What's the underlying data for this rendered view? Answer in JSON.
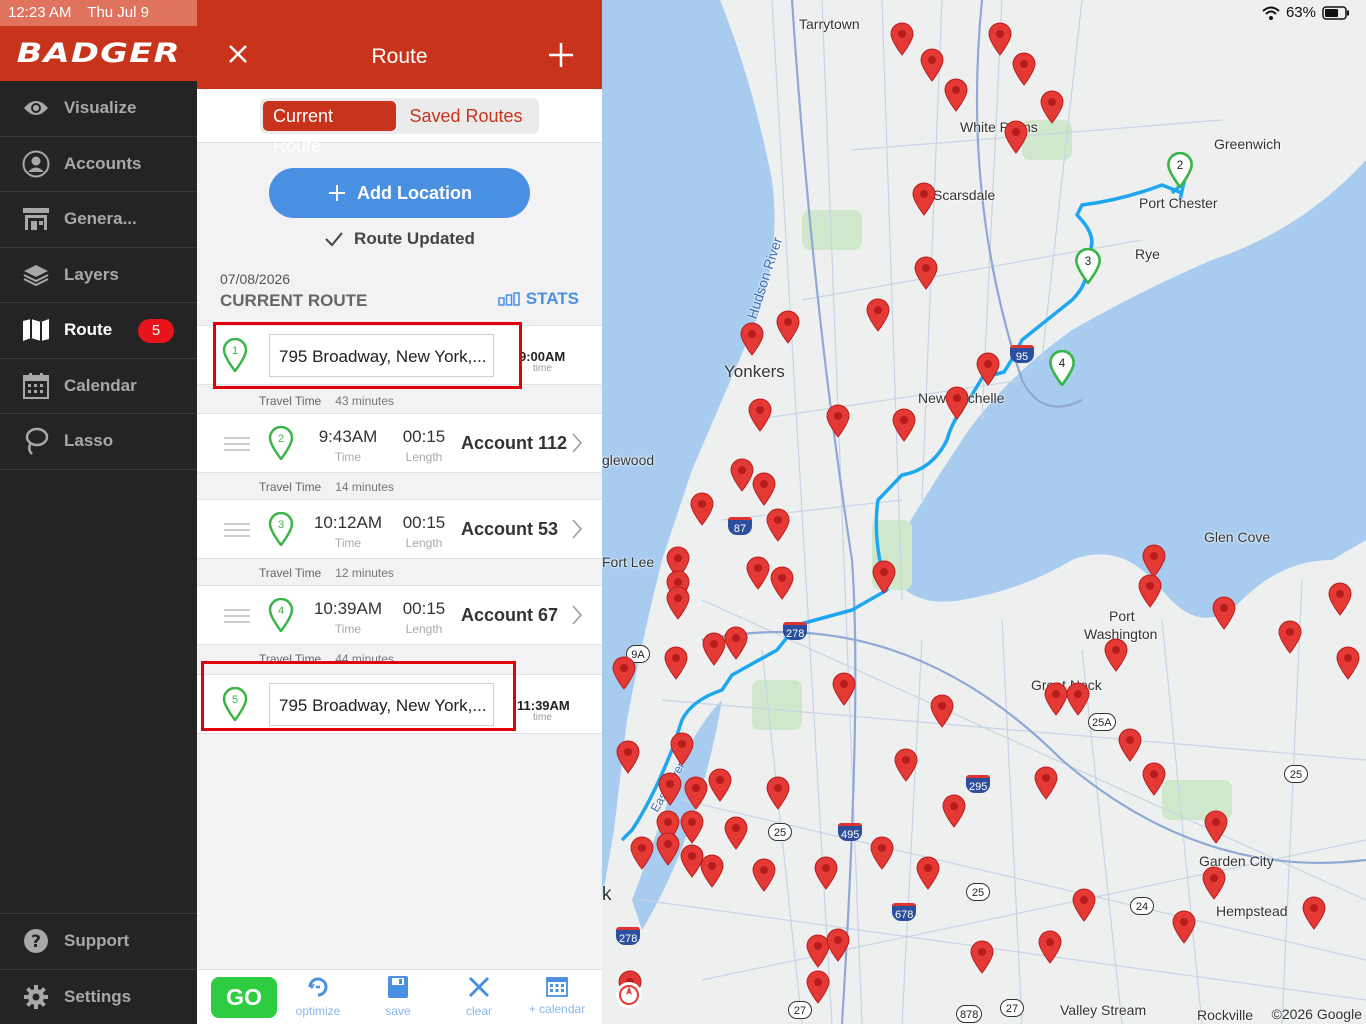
{
  "status": {
    "time": "12:23 AM",
    "date": "Thu Jul 9",
    "battery": "63%"
  },
  "brand": {
    "logo": "BADGER"
  },
  "nav": {
    "items": [
      {
        "label": "Visualize",
        "icon": "eye-icon"
      },
      {
        "label": "Accounts",
        "icon": "person-icon"
      },
      {
        "label": "Genera...",
        "icon": "storefront-icon"
      },
      {
        "label": "Layers",
        "icon": "layers-icon"
      },
      {
        "label": "Route",
        "icon": "map-icon",
        "badge": "5"
      },
      {
        "label": "Calendar",
        "icon": "calendar-icon"
      },
      {
        "label": "Lasso",
        "icon": "lasso-icon"
      }
    ],
    "bottom": [
      {
        "label": "Support",
        "icon": "question-icon"
      },
      {
        "label": "Settings",
        "icon": "gear-icon"
      }
    ]
  },
  "panel": {
    "title": "Route",
    "tabs": {
      "current": "Current Route",
      "saved": "Saved Routes"
    },
    "add_location": "Add Location",
    "route_updated": "Route Updated",
    "date": "07/08/2026",
    "heading": "CURRENT ROUTE",
    "stats": "STATS",
    "start": {
      "pin": "1",
      "address": "795 Broadway, New York,...",
      "time": "9:00AM",
      "time_label": "time"
    },
    "travel": [
      {
        "label": "Travel Time",
        "value": "43 minutes"
      },
      {
        "label": "Travel Time",
        "value": "14 minutes"
      },
      {
        "label": "Travel Time",
        "value": "12 minutes"
      },
      {
        "label": "Travel Time",
        "value": "44 minutes"
      }
    ],
    "stops": [
      {
        "pin": "2",
        "time": "9:43AM",
        "time_label": "Time",
        "length": "00:15",
        "length_label": "Length",
        "account": "Account 112"
      },
      {
        "pin": "3",
        "time": "10:12AM",
        "time_label": "Time",
        "length": "00:15",
        "length_label": "Length",
        "account": "Account 53"
      },
      {
        "pin": "4",
        "time": "10:39AM",
        "time_label": "Time",
        "length": "00:15",
        "length_label": "Length",
        "account": "Account 67"
      }
    ],
    "end": {
      "pin": "5",
      "address": "795 Broadway, New York,...",
      "time": "11:39AM",
      "time_label": "time"
    },
    "toolbar": {
      "go": "GO",
      "optimize": "optimize",
      "save": "save",
      "clear": "clear",
      "calendar": "+ calendar"
    }
  },
  "map": {
    "labels": [
      "Tarrytown",
      "White Plains",
      "Greenwich",
      "Port Chester",
      "Scarsdale",
      "Rye",
      "Hudson River",
      "Yonkers",
      "New Rochelle",
      "glewood",
      "Fort Lee",
      "Glen Cove",
      "Port",
      "Washington",
      "Great Neck",
      "Garden City",
      "Hempstead",
      "Valley Stream",
      "Rockville",
      "k",
      "East River"
    ],
    "shields": [
      "95",
      "87",
      "278",
      "9A",
      "25A",
      "295",
      "495",
      "25",
      "678",
      "24",
      "27",
      "878"
    ],
    "route_pins": [
      "2",
      "3",
      "4"
    ],
    "copyright": "©2026 Google"
  },
  "colors": {
    "brand": "#c8331c",
    "accent": "#4a90e2",
    "go": "#2ecc40",
    "route_line": "#1ea7f0",
    "pin_red": "#e53935",
    "pin_green": "#39b54a"
  }
}
